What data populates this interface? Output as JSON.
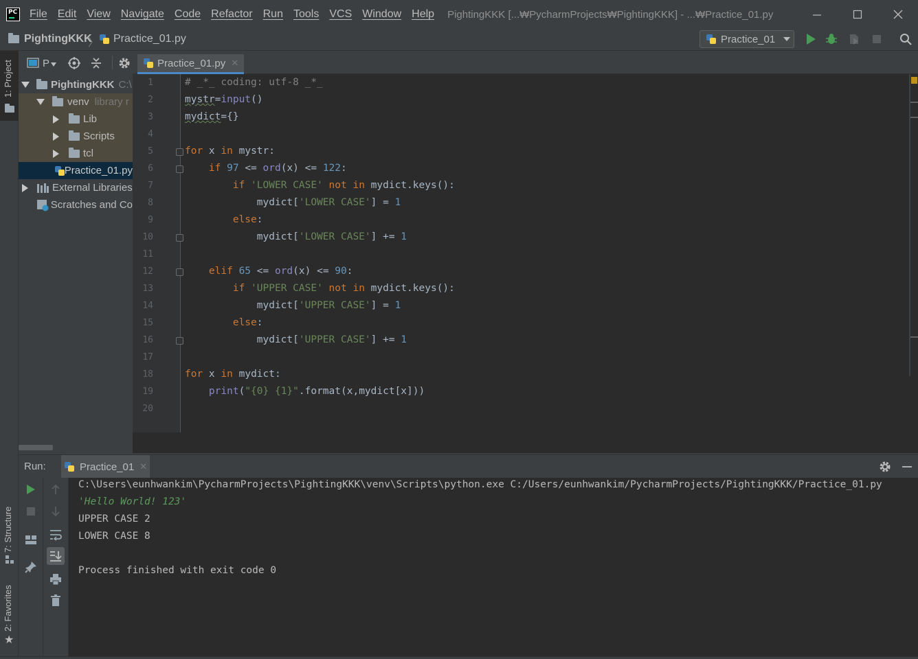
{
  "menu": {
    "items": [
      "File",
      "Edit",
      "View",
      "Navigate",
      "Code",
      "Refactor",
      "Run",
      "Tools",
      "VCS",
      "Window",
      "Help"
    ],
    "window_title": "PightingKKK [...₩PycharmProjects₩PightingKKK] - ...₩Practice_01.py"
  },
  "navbar": {
    "project": "PightingKKK",
    "file": "Practice_01.py",
    "run_config": "Practice_01"
  },
  "left_strip": {
    "project_tab": "1: Project",
    "structure_tab": "7: Structure",
    "favorites_tab": "2: Favorites"
  },
  "project_panel": {
    "header_label": "P",
    "tree": [
      {
        "label": "PightingKKK",
        "suffix": "C:\\"
      },
      {
        "label": "venv",
        "suffix": "library r"
      },
      {
        "label": "Lib"
      },
      {
        "label": "Scripts"
      },
      {
        "label": "tcl"
      },
      {
        "label": "Practice_01.py"
      },
      {
        "label": "External Libraries"
      },
      {
        "label": "Scratches and Co"
      }
    ]
  },
  "editor": {
    "tab_label": "Practice_01.py",
    "line_numbers": [
      "1",
      "2",
      "3",
      "4",
      "5",
      "6",
      "7",
      "8",
      "9",
      "10",
      "11",
      "12",
      "13",
      "14",
      "15",
      "16",
      "17",
      "18",
      "19",
      "20"
    ]
  },
  "run_panel": {
    "label": "Run:",
    "tab_label": "Practice_01",
    "console": [
      "C:\\Users\\eunhwankim\\PycharmProjects\\PightingKKK\\venv\\Scripts\\python.exe C:/Users/eunhwankim/PycharmProjects/PightingKKK/Practice_01.py",
      "'Hello World! 123'",
      "UPPER CASE 2",
      "LOWER CASE 8",
      "",
      "Process finished with exit code 0"
    ]
  },
  "colors": {
    "background": "#3c3f41",
    "editor_bg": "#2b2b2b",
    "keyword": "#cc7832",
    "string": "#6a8759",
    "number": "#6897bb",
    "run_green": "#499c54"
  }
}
